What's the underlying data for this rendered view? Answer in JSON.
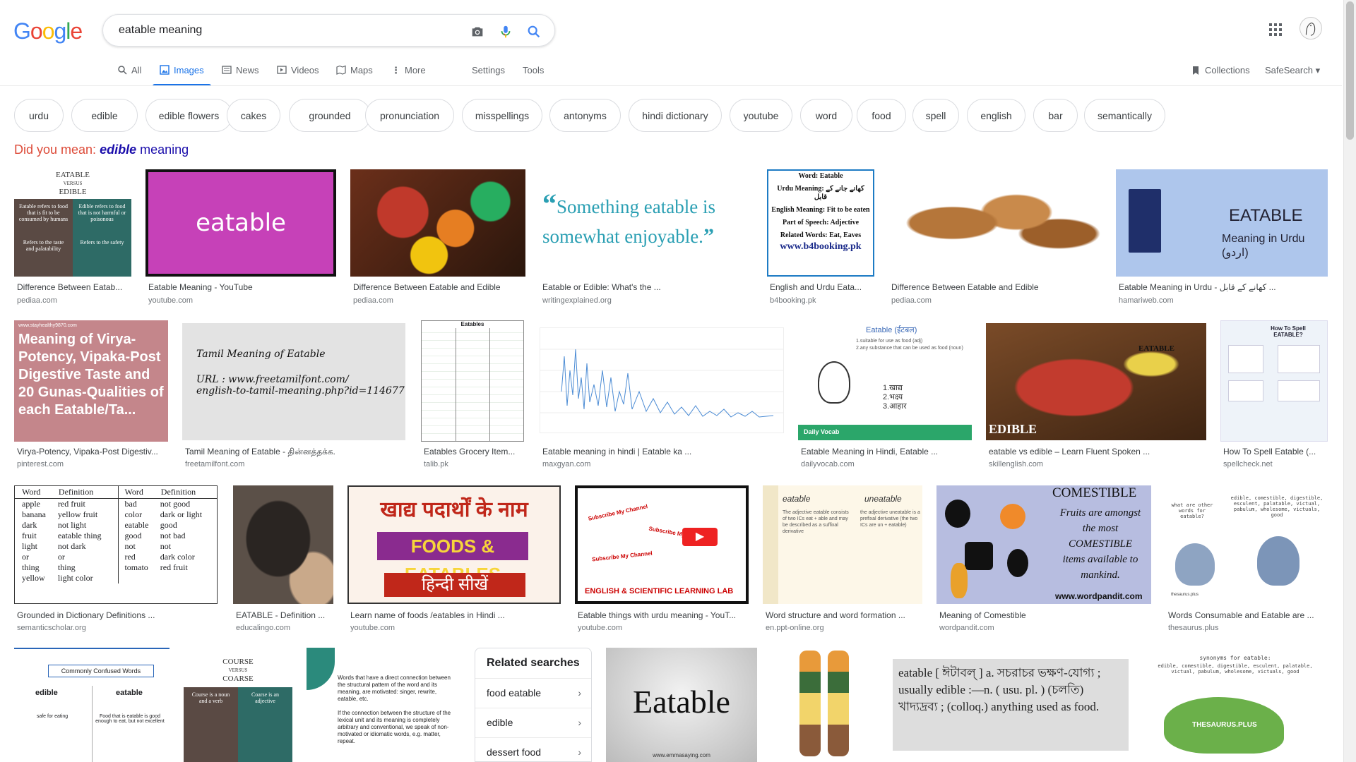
{
  "logo_text": "Google",
  "search": {
    "value": "eatable meaning"
  },
  "tabs": [
    {
      "label": "All"
    },
    {
      "label": "Images"
    },
    {
      "label": "News"
    },
    {
      "label": "Videos"
    },
    {
      "label": "Maps"
    },
    {
      "label": "More"
    },
    {
      "label": "Settings"
    },
    {
      "label": "Tools"
    }
  ],
  "header_links": {
    "collections": "Collections",
    "safesearch": "SafeSearch"
  },
  "chips": [
    "urdu",
    "edible",
    "edible flowers",
    "cakes",
    "grounded",
    "pronunciation",
    "misspellings",
    "antonyms",
    "hindi dictionary",
    "youtube",
    "word",
    "food",
    "spell",
    "english",
    "bar",
    "semantically"
  ],
  "did_you_mean": {
    "prefix": "Did you mean:",
    "bold": "edible",
    "rest": "meaning"
  },
  "results": [
    {
      "caption": "Difference Between Eatab...",
      "source": "pediaa.com"
    },
    {
      "caption": "Eatable Meaning - YouTube",
      "source": "youtube.com"
    },
    {
      "caption": "Difference Between Eatable and Edible",
      "source": "pediaa.com"
    },
    {
      "caption": "Eatable or Edible: What's the ...",
      "source": "writingexplained.org"
    },
    {
      "caption": "English and Urdu Eata...",
      "source": "b4booking.pk"
    },
    {
      "caption": "Difference Between Eatable and Edible",
      "source": "pediaa.com"
    },
    {
      "caption": "Eatable Meaning in Urdu - کھانے کے قابل ...",
      "source": "hamariweb.com"
    },
    {
      "caption": "Virya-Potency, Vipaka-Post Digestiv...",
      "source": "pinterest.com"
    },
    {
      "caption": "Tamil Meaning of Eatable - தின்னத்தக்க.",
      "source": "freetamilfont.com"
    },
    {
      "caption": "Eatables Grocery Item...",
      "source": "talib.pk"
    },
    {
      "caption": "Eatable meaning in hindi | Eatable ka ...",
      "source": "maxgyan.com"
    },
    {
      "caption": "Eatable Meaning in Hindi, Eatable ...",
      "source": "dailyvocab.com"
    },
    {
      "caption": "eatable vs edible – Learn Fluent Spoken ...",
      "source": "skillenglish.com"
    },
    {
      "caption": "How To Spell Eatable (...",
      "source": "spellcheck.net"
    },
    {
      "caption": "Grounded in Dictionary Definitions ...",
      "source": "semanticscholar.org"
    },
    {
      "caption": "EATABLE - Definition ...",
      "source": "educalingo.com"
    },
    {
      "caption": "Learn name of foods /eatables in Hindi ...",
      "source": "youtube.com"
    },
    {
      "caption": "Eatable things with urdu meaning - YouT...",
      "source": "youtube.com"
    },
    {
      "caption": "Word structure and word formation ...",
      "source": "en.ppt-online.org"
    },
    {
      "caption": "Meaning of Comestible",
      "source": "wordpandit.com"
    },
    {
      "caption": "Words Consumable and Eatable are ...",
      "source": "thesaurus.plus"
    }
  ],
  "thumb_text": {
    "t1_title": "EATABLE",
    "t1_versus": "VERSUS",
    "t1_edible": "EDIBLE",
    "t1_left": "Eatable refers to food that is fit to be consumed by humans",
    "t1_right": "Edible refers to food that is not harmful or poisonous",
    "t1_left2": "Refers to the taste and palatability",
    "t1_right2": "Refers to the safety",
    "t2": "eatable",
    "t4_line1": "Something eatable is",
    "t4_line2": "somewhat enjoyable.",
    "t5_title": "Word: Eatable",
    "t5_urdu": "Urdu Meaning: کھانے جانے کے قابل",
    "t5_en": "English Meaning: Fit to be eaten",
    "t5_pos": "Part of Speech: Adjective",
    "t5_rel": "Related Words: Eat, Eaves",
    "t5_url": "www.b4booking.pk",
    "t7_title": "EATABLE",
    "t7_sub": "Meaning in Urdu (اردو)",
    "t8_url": "www.stayhealthy9870.com",
    "t8_text": "Meaning of Virya-Potency, Vipaka-Post Digestive Taste and 20 Gunas-Qualities of each Eatable/Ta...",
    "t9_line1": "Tamil Meaning of Eatable",
    "t9_line2": "URL : www.freetamilfont.com/",
    "t9_line3": "english-to-tamil-meaning.php?id=114677",
    "t10_title": "Eatables",
    "t12_title": "Eatable (ईटबल)",
    "t12_def1": "1.suitable for use as food (adj)",
    "t12_def2": "2.any substance that can be used as food (noun)",
    "t12_h1": "1.खाद्य",
    "t12_h2": "2.भक्ष्य",
    "t12_h3": "3.आहार",
    "t12_brand": "Daily Vocab",
    "t13_label": "EATABLE",
    "t13_label2": "EDIBLE",
    "t14_title": "How To Spell EATABLE?",
    "t15_headers": [
      "Word",
      "Definition",
      "Word",
      "Definition"
    ],
    "t15_rows": [
      [
        "apple",
        "red fruit",
        "bad",
        "not good"
      ],
      [
        "banana",
        "yellow fruit",
        "color",
        "dark or light"
      ],
      [
        "dark",
        "not light",
        "eatable",
        "good"
      ],
      [
        "fruit",
        "eatable thing",
        "good",
        "not bad"
      ],
      [
        "light",
        "not dark",
        "not",
        "not"
      ],
      [
        "or",
        "or",
        "red",
        "dark color"
      ],
      [
        "thing",
        "thing",
        "tomato",
        "red fruit"
      ],
      [
        "yellow",
        "light color",
        "",
        ""
      ]
    ],
    "t17_hindi": "खाद्य पदार्थों के नाम",
    "t17_en": "FOODS & EATABLES",
    "t17_hindi2": "हिन्दी सीखें",
    "t18_sub": "Subscribe My Channel",
    "t18_bottom": "ENGLISH & SCIENTIFIC LEARNING LAB",
    "t19_left": "eatable",
    "t19_right": "uneatable",
    "t19_lt": "The adjective eatable consists of two ICs eat + able and may be described as a suffixal derivative",
    "t19_rt": "the adjective uneatable is a prefixal derivative (the two ICs are un + eatable)",
    "t20_title": "COMESTIBLE",
    "t20_text": "Fruits are amongst the most COMESTIBLE items available to mankind.",
    "t20_url": "www.wordpandit.com",
    "t21_q": "what are other words for eatable?",
    "t21_words": "edible, comestible, digestible, esculent, palatable, victual, pabulum, wholesome, victuals, good",
    "t21_brand": "thesaurus.plus",
    "b1_title": "Commonly Confused Words",
    "b1_edible": "edible",
    "b1_eatable": "eatable",
    "b1_adj": "adj.",
    "b1_m1": "safe for eating",
    "b1_m2": "Food that is eatable is good enough to eat, but not excellent",
    "b2_title": "COURSE",
    "b2_versus": "VERSUS",
    "b2_coarse": "COARSE",
    "b2_l": "Course is a noun and a verb",
    "b2_r": "Coarse is an adjective",
    "b3_text1": "Words that have a direct connection between the structural pattern of the word and its meaning, are motivated: singer, rewrite, eatable, etc.",
    "b3_text2": "If the connection between the structure of the lexical unit and its meaning is completely arbitrary and conventional, we speak of non-motivated or idiomatic words, e.g. matter, repeat.",
    "b5_word": "Eatable",
    "b5_url": "www.emmasaying.com",
    "b7_text": "eatable [ ঈটাবল্ ] a. সচরাচর ভক্ষণ-যোগ্য ; usually edible :—n. ( usu. pl. ) (চলতি) খাদ্যদ্রব্য ; (colloq.) anything used as food.",
    "b8_text": "synonyms for eatable:",
    "b8_words": "edible, comestible, digestible, esculent, palatable, victual, pabulum, wholesome, victuals, good",
    "b8_brand": "THESAURUS.PLUS"
  },
  "related": {
    "title": "Related searches",
    "items": [
      "food eatable",
      "edible",
      "dessert food"
    ]
  },
  "colors": {
    "blue": "#4285f4",
    "red": "#ea4335",
    "yellow": "#fbbc05",
    "green": "#34a853",
    "link": "#1a0dab",
    "accent": "#1a73e8"
  }
}
